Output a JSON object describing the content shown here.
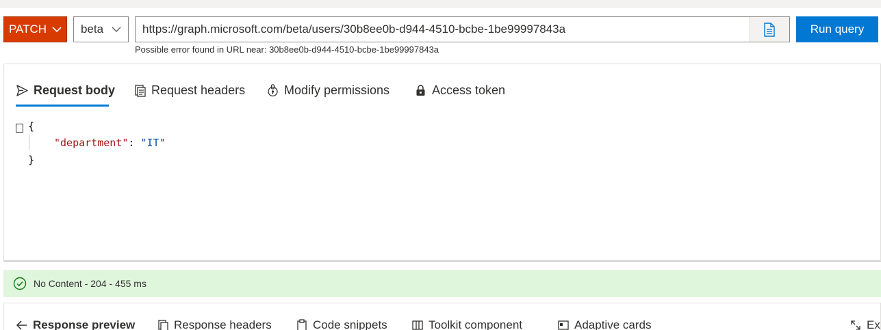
{
  "query": {
    "method": "PATCH",
    "version": "beta",
    "url": "https://graph.microsoft.com/beta/users/30b8ee0b-d944-4510-bcbe-1be99997843a",
    "run_label": "Run query",
    "error_prefix": "Possible error found in URL near:",
    "error_value": "30b8ee0b-d944-4510-bcbe-1be99997843a"
  },
  "request": {
    "tabs": [
      {
        "label": "Request body",
        "icon": "send-icon",
        "active": true
      },
      {
        "label": "Request headers",
        "icon": "headers-icon"
      },
      {
        "label": "Modify permissions",
        "icon": "permissions-icon"
      },
      {
        "label": "Access token",
        "icon": "lock-icon"
      }
    ],
    "body": {
      "open": "{",
      "key": "\"department\"",
      "colon": ": ",
      "value": "\"IT\"",
      "close": "}"
    }
  },
  "status": {
    "text": "No Content - 204 - 455 ms",
    "icon": "success-check-icon"
  },
  "response": {
    "tabs": [
      {
        "label": "Response preview",
        "icon": "back-arrow-icon",
        "active": true
      },
      {
        "label": "Response headers",
        "icon": "headers-icon"
      },
      {
        "label": "Code snippets",
        "icon": "clipboard-icon"
      },
      {
        "label": "Toolkit component",
        "icon": "toolkit-icon"
      },
      {
        "label": "Adaptive cards",
        "icon": "card-icon"
      },
      {
        "label": "Expand",
        "icon": "expand-icon"
      }
    ]
  },
  "colors": {
    "method_bg": "#d83b01",
    "run_bg": "#0078d4",
    "tab_underline": "#0078d4",
    "status_bg": "#dff6dd",
    "status_icon": "#107c10"
  }
}
